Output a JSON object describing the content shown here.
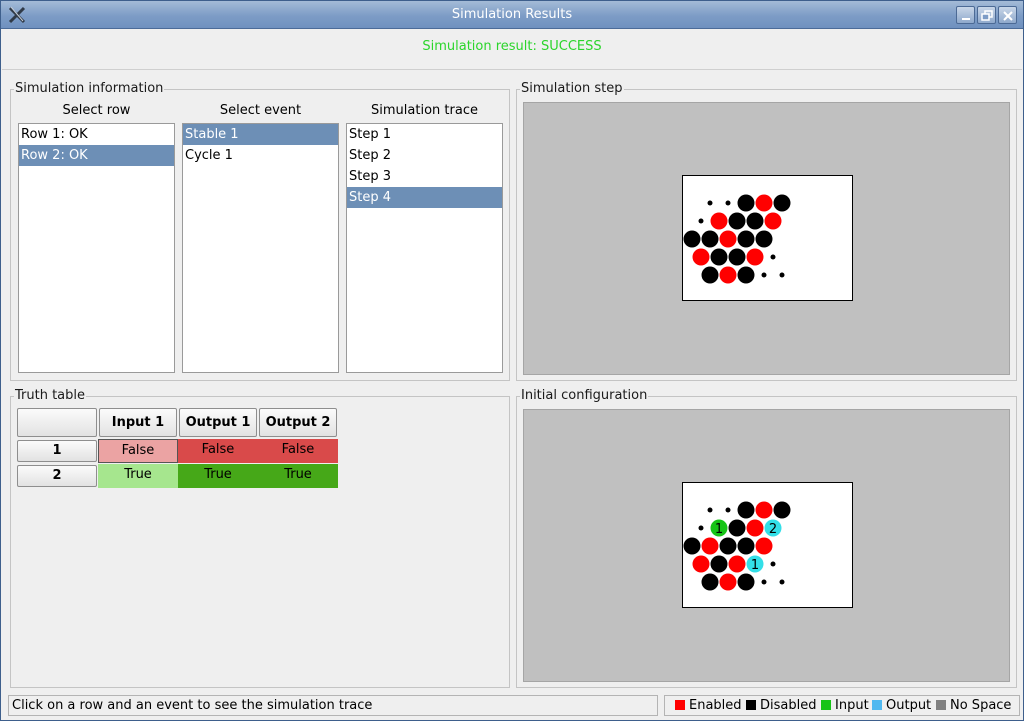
{
  "window": {
    "title": "Simulation Results"
  },
  "result": {
    "text": "Simulation result: SUCCESS",
    "color": "#2bd52b"
  },
  "sim_info": {
    "title": "Simulation information",
    "select_row": {
      "header": "Select row",
      "items": [
        "Row 1: OK",
        "Row 2: OK"
      ],
      "selected": 1
    },
    "select_event": {
      "header": "Select event",
      "items": [
        "Stable 1",
        "Cycle 1"
      ],
      "selected": 0
    },
    "trace": {
      "header": "Simulation trace",
      "items": [
        "Step 1",
        "Step 2",
        "Step 3",
        "Step 4"
      ],
      "selected": 3
    }
  },
  "sim_step": {
    "title": "Simulation step"
  },
  "initial_config": {
    "title": "Initial configuration"
  },
  "truth_table": {
    "title": "Truth table",
    "headers": [
      "Input 1",
      "Output 1",
      "Output 2"
    ],
    "rows": [
      {
        "label": "1",
        "cells": [
          "False",
          "False",
          "False"
        ]
      },
      {
        "label": "2",
        "cells": [
          "True",
          "True",
          "True"
        ]
      }
    ],
    "colors": {
      "false_input": "#eba3a3",
      "false_output": "#d94a4a",
      "true_input": "#a6e68e",
      "true_output": "#46a818"
    }
  },
  "status": {
    "text": "Click on a row and an event to see the simulation trace"
  },
  "legend": [
    {
      "label": "Enabled",
      "color": "#ff0000"
    },
    {
      "label": "Disabled",
      "color": "#000000"
    },
    {
      "label": "Input",
      "color": "#17c417"
    },
    {
      "label": "Output",
      "color": "#4fb8f0"
    },
    {
      "label": "No Space",
      "color": "#808080"
    }
  ],
  "boards": {
    "step": [
      [
        "dot",
        "dot",
        "black",
        "red",
        "black"
      ],
      [
        "dot",
        "red",
        "black",
        "black",
        "red"
      ],
      [
        "black",
        "black",
        "red",
        "black",
        "black"
      ],
      [
        "red",
        "black",
        "black",
        "red",
        "dot"
      ],
      [
        "black",
        "red",
        "black",
        "dot",
        "dot"
      ]
    ],
    "initial": [
      [
        "dot",
        "dot",
        "black",
        "red",
        "black"
      ],
      [
        "dot",
        "input",
        "black",
        "red",
        "output"
      ],
      [
        "black",
        "red",
        "black",
        "black",
        "red"
      ],
      [
        "red",
        "black",
        "red",
        "output",
        "dot"
      ],
      [
        "black",
        "red",
        "black",
        "dot",
        "dot"
      ]
    ],
    "initial_labels": {
      "1-1": "1",
      "1-4": "2",
      "3-3": "1"
    },
    "colors": {
      "red": "#ff0000",
      "black": "#000000",
      "input": "#17c417",
      "output": "#33dfe8"
    }
  }
}
